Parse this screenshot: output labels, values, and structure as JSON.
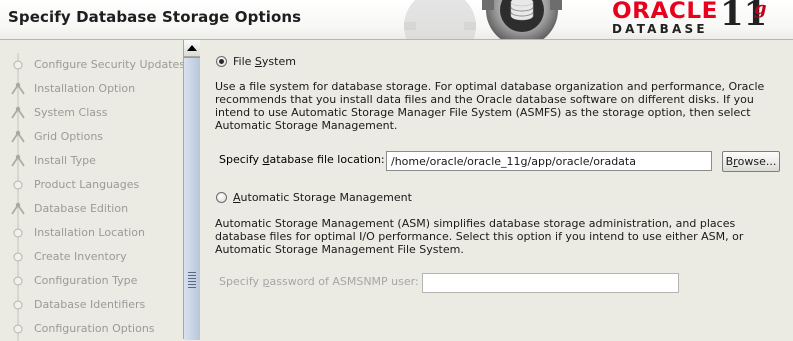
{
  "header": {
    "title": "Specify Database Storage Options",
    "logo_oracle": "ORACLE",
    "logo_database": "DATABASE",
    "logo_version": "11",
    "logo_version_suffix": "g"
  },
  "sidebar": {
    "steps": [
      {
        "label": "Configure Security Updates"
      },
      {
        "label": "Installation Option"
      },
      {
        "label": "System Class"
      },
      {
        "label": "Grid Options"
      },
      {
        "label": "Install Type"
      },
      {
        "label": "Product Languages"
      },
      {
        "label": "Database Edition"
      },
      {
        "label": "Installation Location"
      },
      {
        "label": "Create Inventory"
      },
      {
        "label": "Configuration Type"
      },
      {
        "label": "Database Identifiers"
      },
      {
        "label": "Configuration Options"
      }
    ]
  },
  "main": {
    "file_system": {
      "option_label_pre": "File ",
      "option_label_mnemonic": "S",
      "option_label_post": "ystem",
      "selected": true,
      "description": "Use a file system for database storage. For optimal database organization and performance, Oracle recommends that you install data files and the Oracle database software on different disks. If you intend to use Automatic Storage Manager File System (ASMFS) as the storage option, then select Automatic Storage Management.",
      "location_label_pre": "Specify ",
      "location_label_mnemonic": "d",
      "location_label_post": "atabase file location:",
      "location_value": "/home/oracle/oracle_11g/app/oracle/oradata",
      "browse_label_pre": "B",
      "browse_label_mnemonic": "r",
      "browse_label_post": "owse..."
    },
    "asm": {
      "option_label_mnemonic": "A",
      "option_label_post": "utomatic Storage Management",
      "selected": false,
      "description": "Automatic Storage Management (ASM) simplifies database storage administration, and places database files for optimal I/O performance. Select this option if you intend to use either ASM, or Automatic Storage Management File System.",
      "password_label_pre": "Specify ",
      "password_label_mnemonic": "p",
      "password_label_post": "assword of ASMSNMP user:",
      "password_value": ""
    }
  }
}
